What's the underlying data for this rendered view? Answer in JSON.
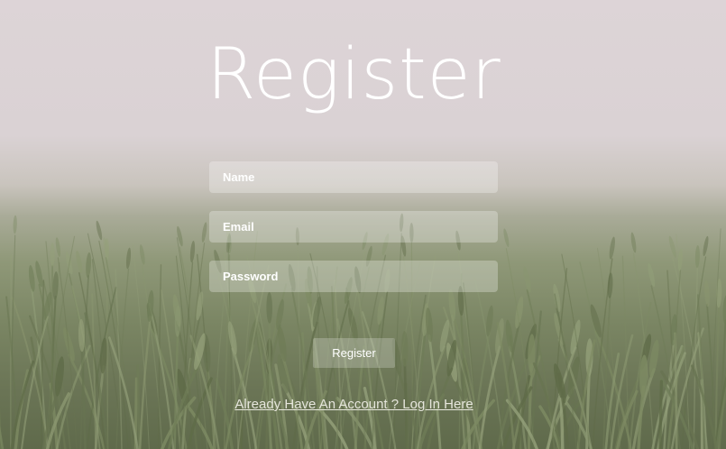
{
  "page": {
    "title": "Register",
    "background_description_color": "#dad2d4"
  },
  "form": {
    "name_placeholder": "Name",
    "email_placeholder": "Email",
    "password_placeholder": "Password",
    "submit_label": "Register"
  },
  "footer": {
    "login_link": "Already Have An Account ? Log In Here"
  },
  "colors": {
    "text": "#ffffff",
    "field_bg": "rgba(255,255,255,0.28)"
  }
}
